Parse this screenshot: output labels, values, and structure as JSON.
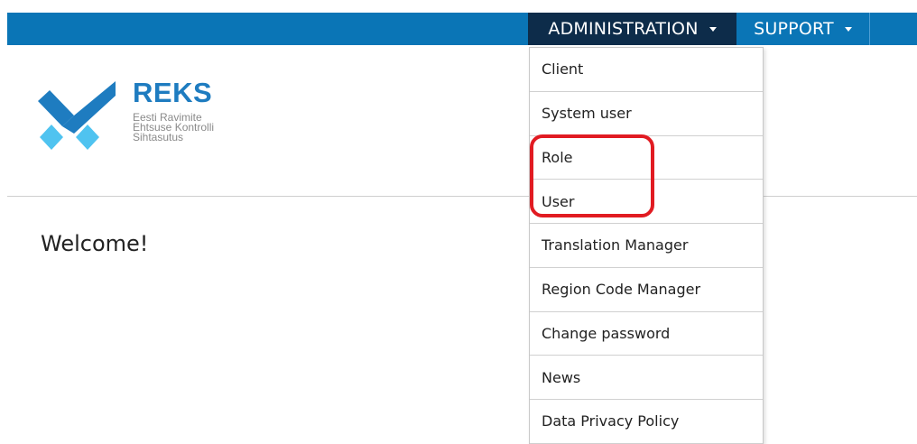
{
  "navbar": {
    "items": [
      {
        "label": "ADMINISTRATION"
      },
      {
        "label": "SUPPORT"
      }
    ]
  },
  "logo": {
    "word": "REKS",
    "subtitle": [
      "Eesti Ravimite",
      "Ehtsuse Kontrolli",
      "Sihtasutus"
    ]
  },
  "main": {
    "welcome": "Welcome!"
  },
  "dropdown": {
    "items": [
      {
        "label": "Client"
      },
      {
        "label": "System user"
      },
      {
        "label": "Role"
      },
      {
        "label": "User"
      },
      {
        "label": "Translation Manager"
      },
      {
        "label": "Region Code Manager"
      },
      {
        "label": "Change password"
      },
      {
        "label": "News"
      },
      {
        "label": "Data Privacy Policy"
      }
    ]
  },
  "colors": {
    "topbar": "#0a75b6",
    "active_nav": "#0d2c4a",
    "brand_blue": "#1e7cc0",
    "brand_light": "#4fc3f0",
    "highlight": "#e11b22"
  }
}
